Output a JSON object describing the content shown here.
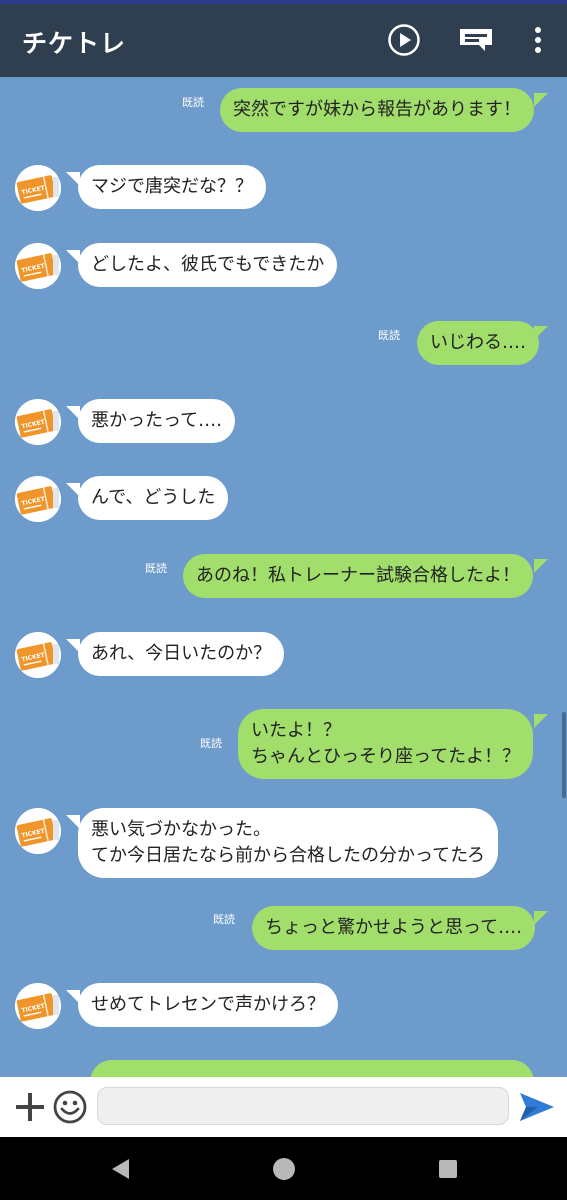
{
  "header": {
    "title": "チケトレ",
    "icons": [
      "play-icon",
      "note-icon",
      "more-vertical-icon"
    ]
  },
  "colors": {
    "header_bg": "#2f3f4f",
    "chat_bg": "#6d9bcb",
    "outgoing_bubble": "#a2de6b",
    "incoming_bubble": "#ffffff",
    "send_icon": "#2f7bd6"
  },
  "messages": [
    {
      "dir": "out",
      "read": "既読",
      "lines": [
        "突然ですが妹から報告があります！"
      ]
    },
    {
      "dir": "in",
      "lines": [
        "マジで唐突だな？？"
      ]
    },
    {
      "dir": "in",
      "lines": [
        "どしたよ、彼氏でもできたか"
      ]
    },
    {
      "dir": "out",
      "read": "既読",
      "lines": [
        "いじわる‥‥"
      ]
    },
    {
      "dir": "in",
      "lines": [
        "悪かったって‥‥"
      ]
    },
    {
      "dir": "in",
      "lines": [
        "んで、どうした"
      ]
    },
    {
      "dir": "out",
      "read": "既読",
      "lines": [
        "あのね！私トレーナー試験合格したよ！"
      ]
    },
    {
      "dir": "in",
      "lines": [
        "あれ、今日いたのか？"
      ]
    },
    {
      "dir": "out",
      "read": "既読",
      "lines": [
        "いたよ！？",
        "ちゃんとひっそり座ってたよ！？"
      ]
    },
    {
      "dir": "in",
      "lines": [
        "悪い気づかなかった。",
        "てか今日居たなら前から合格したの分かってたろ"
      ]
    },
    {
      "dir": "out",
      "read": "既読",
      "lines": [
        "ちょっと驚かせようと思って‥‥"
      ]
    },
    {
      "dir": "in",
      "lines": [
        "せめてトレセンで声かけろ？"
      ]
    }
  ],
  "avatar": {
    "label": "TICKET"
  },
  "input": {
    "placeholder": "",
    "value": ""
  },
  "nav": {
    "icons": [
      "back-icon",
      "home-icon",
      "recents-icon"
    ]
  }
}
